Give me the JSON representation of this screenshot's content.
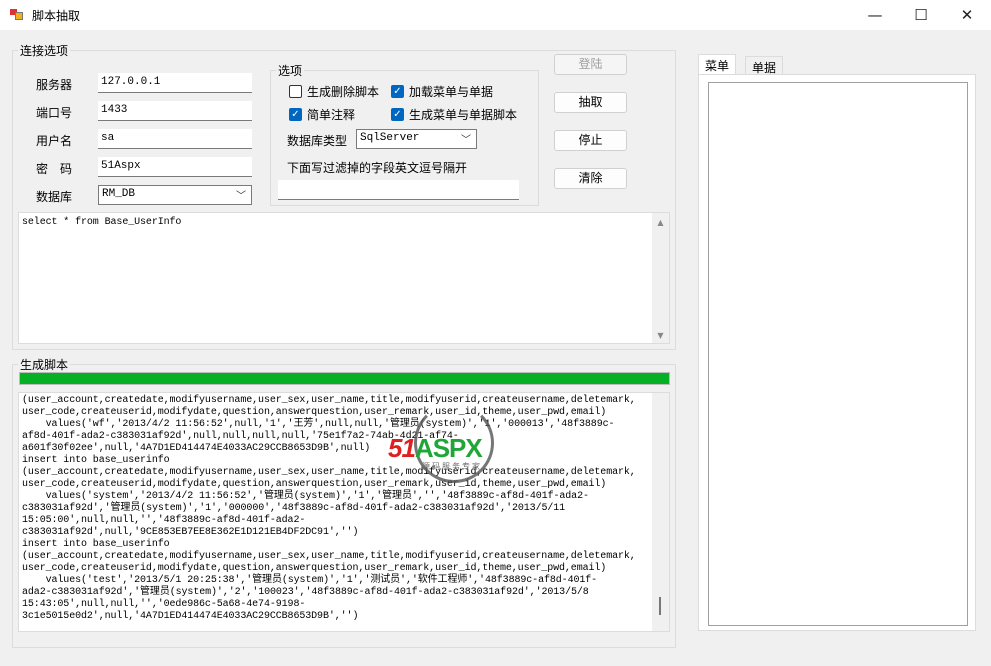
{
  "window": {
    "title": "脚本抽取",
    "minimize": "—",
    "maximize": "☐",
    "close": "✕"
  },
  "connection": {
    "group_label": "连接选项",
    "server_label": "服务器",
    "server_value": "127.0.0.1",
    "port_label": "端口号",
    "port_value": "1433",
    "user_label": "用户名",
    "user_value": "sa",
    "password_label": "密　码",
    "password_value": "51Aspx",
    "database_label": "数据库",
    "database_value": "RM_DB"
  },
  "options": {
    "group_label": "选项",
    "gen_delete_label": "生成删除脚本",
    "gen_delete_checked": false,
    "load_menu_label": "加载菜单与单据",
    "load_menu_checked": true,
    "simple_comment_label": "简单注释",
    "simple_comment_checked": true,
    "gen_menu_script_label": "生成菜单与单据脚本",
    "gen_menu_script_checked": true,
    "dbtype_label": "数据库类型",
    "dbtype_value": "SqlServer",
    "filter_label": "下面写过滤掉的字段英文逗号隔开",
    "filter_value": ""
  },
  "buttons": {
    "login": "登陆",
    "extract": "抽取",
    "stop": "停止",
    "clear": "清除"
  },
  "query": "select * from Base_UserInfo",
  "output": {
    "group_label": "生成脚本",
    "progress": 100,
    "progress_color": "#06b025",
    "lines": [
      "(user_account,createdate,modifyusername,user_sex,user_name,title,modifyuserid,createusername,deletemark,",
      "user_code,createuserid,modifydate,question,answerquestion,user_remark,user_id,theme,user_pwd,email)",
      "    values('wf','2013/4/2 11:56:52',null,'1','王芳',null,null,'管理员(system)','1','000013','48f3889c-",
      "af8d-401f-ada2-c383031af92d',null,null,null,null,'75e1f7a2-74ab-4d21-af74-",
      "a601f30f02ee',null,'4A7D1ED414474E4033AC29CCB8653D9B',null)",
      "insert into base_userinfo",
      "(user_account,createdate,modifyusername,user_sex,user_name,title,modifyuserid,createusername,deletemark,",
      "user_code,createuserid,modifydate,question,answerquestion,user_remark,user_id,theme,user_pwd,email)",
      "    values('system','2013/4/2 11:56:52','管理员(system)','1','管理员','','48f3889c-af8d-401f-ada2-",
      "c383031af92d','管理员(system)','1','000000','48f3889c-af8d-401f-ada2-c383031af92d','2013/5/11",
      "15:05:00',null,null,'','48f3889c-af8d-401f-ada2-",
      "c383031af92d',null,'9CE853EB7EE8E362E1D121EB4DF2DC91','')",
      "insert into base_userinfo",
      "(user_account,createdate,modifyusername,user_sex,user_name,title,modifyuserid,createusername,deletemark,",
      "user_code,createuserid,modifydate,question,answerquestion,user_remark,user_id,theme,user_pwd,email)",
      "    values('test','2013/5/1 20:25:38','管理员(system)','1','测试员','软件工程师','48f3889c-af8d-401f-",
      "ada2-c383031af92d','管理员(system)','2','100023','48f3889c-af8d-401f-ada2-c383031af92d','2013/5/8",
      "15:43:05',null,null,'','0ede986c-5a68-4e74-9198-",
      "3c1e5015e0d2',null,'4A7D1ED414474E4033AC29CCB8653D9B','')"
    ]
  },
  "watermark": {
    "brand": "51Aspx",
    "tagline": "源码服务专家"
  },
  "right_panel": {
    "tabs": [
      "菜单",
      "单据"
    ]
  }
}
